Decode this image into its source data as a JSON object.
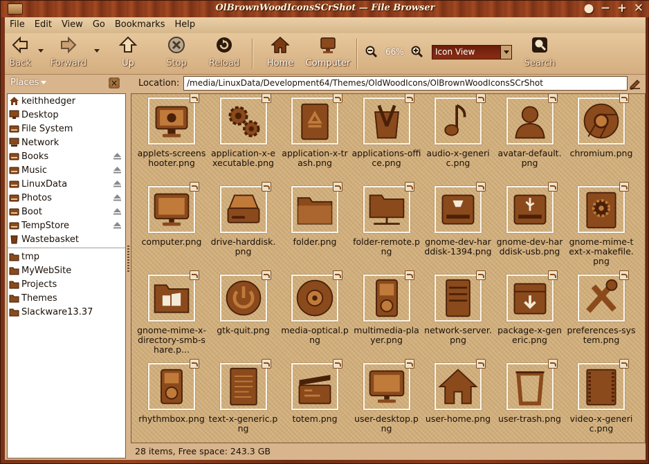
{
  "window": {
    "title": "OlBrownWoodIconsSCrShot — File Browser",
    "controls": [
      "●",
      "−",
      "+",
      "✕"
    ]
  },
  "menubar": [
    {
      "label": "File"
    },
    {
      "label": "Edit"
    },
    {
      "label": "View"
    },
    {
      "label": "Go"
    },
    {
      "label": "Bookmarks"
    },
    {
      "label": "Help"
    }
  ],
  "toolbar": {
    "back": "Back",
    "forward": "Forward",
    "up": "Up",
    "stop": "Stop",
    "reload": "Reload",
    "home": "Home",
    "computer": "Computer",
    "zoom_level": "66%",
    "view_mode": "Icon View",
    "search": "Search"
  },
  "location": {
    "places_label": "Places",
    "label": "Location:",
    "path": "/media/LinuxData/Development64/Themes/OldWoodIcons/OlBrownWoodIconsSCrShot"
  },
  "sidebar": {
    "items": [
      {
        "label": "keithhedger",
        "icon": "home-icon",
        "eject": false
      },
      {
        "label": "Desktop",
        "icon": "desktop-icon",
        "eject": false
      },
      {
        "label": "File System",
        "icon": "drive-icon",
        "eject": false
      },
      {
        "label": "Network",
        "icon": "network-icon",
        "eject": false
      },
      {
        "label": "Books",
        "icon": "drive-icon",
        "eject": true
      },
      {
        "label": "Music",
        "icon": "drive-icon",
        "eject": true
      },
      {
        "label": "LinuxData",
        "icon": "drive-icon",
        "eject": true
      },
      {
        "label": "Photos",
        "icon": "drive-icon",
        "eject": true
      },
      {
        "label": "Boot",
        "icon": "drive-icon",
        "eject": true
      },
      {
        "label": "TempStore",
        "icon": "drive-icon",
        "eject": true
      },
      {
        "label": "Wastebasket",
        "icon": "trash-icon",
        "eject": false
      }
    ],
    "bookmarks": [
      {
        "label": "tmp",
        "icon": "folder-icon"
      },
      {
        "label": "MyWebSite",
        "icon": "folder-icon"
      },
      {
        "label": "Projects",
        "icon": "folder-icon"
      },
      {
        "label": "Themes",
        "icon": "folder-icon"
      },
      {
        "label": "Slackware13.37",
        "icon": "folder-icon"
      }
    ]
  },
  "files": [
    {
      "name": "applets-screenshooter.png",
      "icon": "screenshot-icon"
    },
    {
      "name": "application-x-executable.png",
      "icon": "gears-icon"
    },
    {
      "name": "application-x-trash.png",
      "icon": "recycle-icon"
    },
    {
      "name": "applications-office.png",
      "icon": "office-icon"
    },
    {
      "name": "audio-x-generic.png",
      "icon": "music-note-icon"
    },
    {
      "name": "avatar-default.png",
      "icon": "user-icon"
    },
    {
      "name": "chromium.png",
      "icon": "chromium-icon"
    },
    {
      "name": "computer.png",
      "icon": "monitor-icon"
    },
    {
      "name": "drive-harddisk.png",
      "icon": "harddisk-icon"
    },
    {
      "name": "folder.png",
      "icon": "folder-icon"
    },
    {
      "name": "folder-remote.png",
      "icon": "remote-folder-icon"
    },
    {
      "name": "gnome-dev-harddisk-1394.png",
      "icon": "firewire-disk-icon"
    },
    {
      "name": "gnome-dev-harddisk-usb.png",
      "icon": "usb-disk-icon"
    },
    {
      "name": "gnome-mime-text-x-makefile.png",
      "icon": "makefile-icon"
    },
    {
      "name": "gnome-mime-x-directory-smb-share.p...",
      "icon": "smb-share-icon"
    },
    {
      "name": "gtk-quit.png",
      "icon": "power-icon"
    },
    {
      "name": "media-optical.png",
      "icon": "disc-icon"
    },
    {
      "name": "multimedia-player.png",
      "icon": "player-icon"
    },
    {
      "name": "network-server.png",
      "icon": "server-icon"
    },
    {
      "name": "package-x-generic.png",
      "icon": "package-icon"
    },
    {
      "name": "preferences-system.png",
      "icon": "tools-icon"
    },
    {
      "name": "rhythmbox.png",
      "icon": "ipod-icon"
    },
    {
      "name": "text-x-generic.png",
      "icon": "text-icon"
    },
    {
      "name": "totem.png",
      "icon": "film-icon"
    },
    {
      "name": "user-desktop.png",
      "icon": "monitor-icon"
    },
    {
      "name": "user-home.png",
      "icon": "home-icon"
    },
    {
      "name": "user-trash.png",
      "icon": "trash-icon"
    },
    {
      "name": "video-x-generic.png",
      "icon": "video-icon"
    }
  ],
  "status": "28 items, Free space: 243.3 GB",
  "colors": {
    "wood_dark": "#5a2a0e",
    "wood_mid": "#8b4a1c",
    "wood_light": "#c07a3a",
    "accent": "#6a1e0c"
  }
}
